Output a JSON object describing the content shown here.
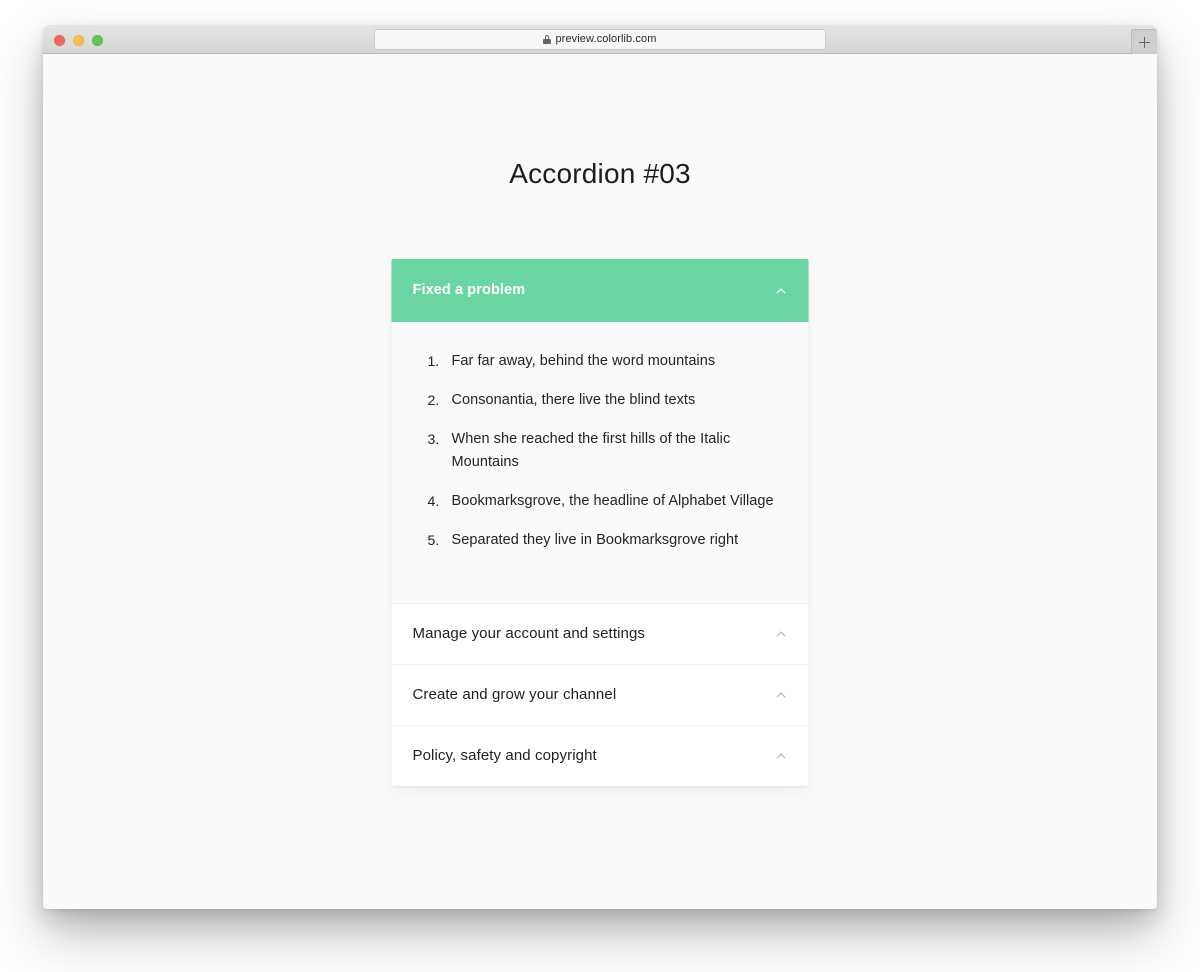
{
  "browser": {
    "traffic_lights": [
      {
        "name": "close",
        "color": "#ee6a5f"
      },
      {
        "name": "minimize",
        "color": "#f5c04f"
      },
      {
        "name": "zoom",
        "color": "#62c554"
      }
    ],
    "address_bar": {
      "url": "preview.colorlib.com",
      "lock_icon": "lock-icon",
      "reload_icon": "reload-icon"
    },
    "new_tab_icon": "plus-icon"
  },
  "page": {
    "title": "Accordion #03",
    "accent_color": "#6bd6a3",
    "background_color": "#fafafa"
  },
  "accordion": {
    "items": [
      {
        "title": "Fixed a problem",
        "expanded": true,
        "chevron_icon": "chevron-up-icon",
        "list": [
          "Far far away, behind the word mountains",
          "Consonantia, there live the blind texts",
          "When she reached the first hills of the Italic Mountains",
          "Bookmarksgrove, the headline of Alphabet Village",
          "Separated they live in Bookmarksgrove right"
        ]
      },
      {
        "title": "Manage your account and settings",
        "expanded": false,
        "chevron_icon": "chevron-up-icon",
        "list": []
      },
      {
        "title": "Create and grow your channel",
        "expanded": false,
        "chevron_icon": "chevron-up-icon",
        "list": []
      },
      {
        "title": "Policy, safety and copyright",
        "expanded": false,
        "chevron_icon": "chevron-up-icon",
        "list": []
      }
    ]
  }
}
